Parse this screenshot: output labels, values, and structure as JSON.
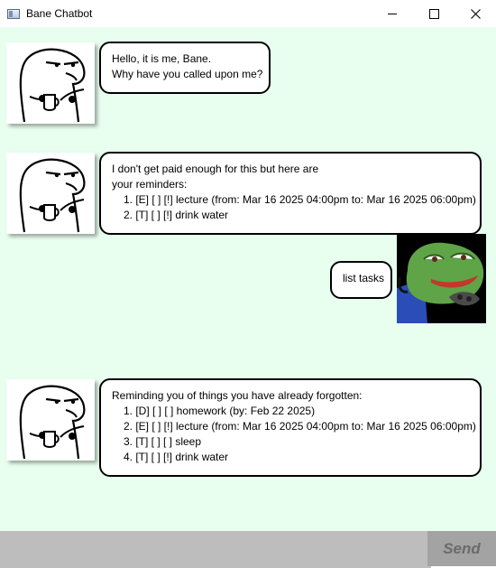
{
  "window": {
    "title": "Bane Chatbot",
    "minimize_glyph": "—",
    "maximize_glyph": "☐",
    "close_glyph": "✕"
  },
  "colors": {
    "chat_background": "#e8fff0",
    "input_background": "#bdbdbd",
    "send_background": "#a3a3a3",
    "send_text": "#6b6b6b"
  },
  "messages": [
    {
      "sender": "bot",
      "avatar_icon": "bane-avatar-icon",
      "lines": [
        "Hello, it is me, Bane.",
        "Why have you called upon me?"
      ]
    },
    {
      "sender": "bot",
      "avatar_icon": "bane-avatar-icon",
      "lines": [
        "I don't get paid enough for this but here are",
        "your reminders:",
        "1. [E] [ ] [!] lecture (from: Mar 16 2025 04:00pm to: Mar 16 2025 06:00pm)",
        "2. [T] [ ] [!] drink water"
      ]
    },
    {
      "sender": "user",
      "avatar_icon": "user-avatar-icon",
      "lines": [
        "list tasks"
      ]
    },
    {
      "sender": "bot",
      "avatar_icon": "bane-avatar-icon",
      "lines": [
        "Reminding you of things you have already forgotten:",
        "1. [D] [ ] [ ] homework (by: Feb 22 2025)",
        "2. [E] [ ] [!] lecture (from: Mar 16 2025 04:00pm to: Mar 16 2025 06:00pm)",
        "3. [T] [ ] [ ] sleep",
        "4. [T] [ ] [!] drink water"
      ]
    }
  ],
  "input": {
    "value": "",
    "placeholder": ""
  },
  "send_button": {
    "label": "Send"
  }
}
